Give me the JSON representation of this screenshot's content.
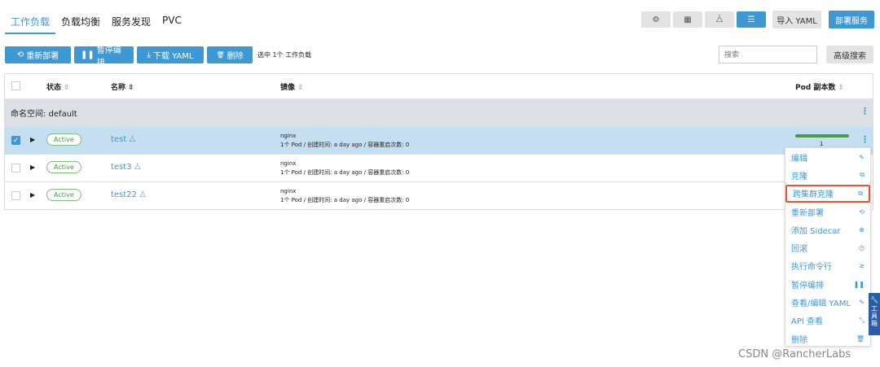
{
  "tabs": [
    "工作负载",
    "负载均衡",
    "服务发现",
    "PVC"
  ],
  "view_buttons": [
    {
      "icon": "gear-icon",
      "glyph": "⚙"
    },
    {
      "icon": "grid-icon",
      "glyph": "▦"
    },
    {
      "icon": "nodes-icon",
      "glyph": "⧊"
    },
    {
      "icon": "list-tree-icon",
      "glyph": "☰"
    }
  ],
  "header_buttons": {
    "import": "导入 YAML",
    "deploy": "部署服务"
  },
  "actions": {
    "redeploy": "重新部署",
    "pause": "暂停编排",
    "download": "下载 YAML",
    "delete": "删除",
    "selection_info": "选中 1个 工作负载",
    "icons": {
      "redeploy": "⟲",
      "pause": "❚❚",
      "download": "⤓",
      "delete": "🗑"
    }
  },
  "search": {
    "placeholder": "搜索"
  },
  "advanced_search": "高级搜索",
  "columns": {
    "status": "状态",
    "name": "名称",
    "image": "镜像",
    "pods": "Pod 副本数",
    "sort_icon": "⇳"
  },
  "namespace": {
    "label": "命名空间: default"
  },
  "rows": [
    {
      "status": "Active",
      "name": "test",
      "image": "nginx",
      "meta": "1个 Pod / 创建时间: a day ago / 容器重启次数: 0",
      "pods": "1",
      "selected": true
    },
    {
      "status": "Active",
      "name": "test3",
      "image": "nginx",
      "meta": "1个 Pod / 创建时间: a day ago / 容器重启次数: 0",
      "pods": "",
      "selected": false
    },
    {
      "status": "Active",
      "name": "test22",
      "image": "nginx",
      "meta": "1个 Pod / 创建时间: a day ago / 容器重启次数: 0",
      "pods": "",
      "selected": false
    }
  ],
  "pod_bar_fill": 1.0,
  "menu": [
    {
      "label": "编辑",
      "icon": "✎",
      "icon_name": "pencil-icon"
    },
    {
      "label": "克隆",
      "icon": "⧉",
      "icon_name": "copy-icon"
    },
    {
      "label": "跨集群克隆",
      "icon": "⧉",
      "icon_name": "copy-icon",
      "highlight": true
    },
    {
      "label": "重新部署",
      "icon": "⟲",
      "icon_name": "redeploy-icon"
    },
    {
      "label": "添加 Sidecar",
      "icon": "⊕",
      "icon_name": "plus-circle-icon"
    },
    {
      "label": "回滚",
      "icon": "◷",
      "icon_name": "history-icon"
    },
    {
      "label": "执行命令行",
      "icon": "≥",
      "icon_name": "terminal-icon"
    },
    {
      "label": "暂停编排",
      "icon": "❚❚",
      "icon_name": "pause-icon"
    },
    {
      "label": "查看/编辑 YAML",
      "icon": "✎",
      "icon_name": "pencil-icon"
    },
    {
      "label": "API 查看",
      "icon": "⤡",
      "icon_name": "api-icon"
    },
    {
      "label": "删除",
      "icon": "🗑",
      "icon_name": "trash-icon"
    }
  ],
  "toolbox": {
    "icon": "🔧",
    "label": "工具箱"
  },
  "watermark": "CSDN @RancherLabs",
  "colors": {
    "accent": "#3d98d3",
    "highlight": "#e8542f",
    "active_green": "#4a9a4a"
  }
}
